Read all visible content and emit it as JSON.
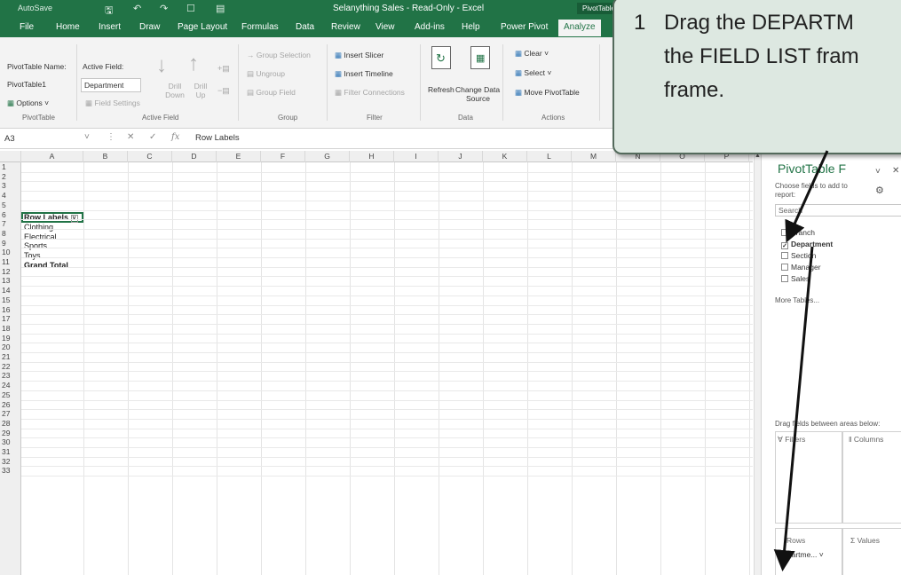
{
  "titlebar": {
    "autosave": "AutoSave",
    "title": "Selanything Sales  -  Read-Only  -  Excel",
    "context_tab": "PivotTable T"
  },
  "ribbon_tabs": [
    "File",
    "Home",
    "Insert",
    "Draw",
    "Page Layout",
    "Formulas",
    "Data",
    "Review",
    "View",
    "Add-ins",
    "Help",
    "Power Pivot",
    "Analyze"
  ],
  "ribbon": {
    "pivottable": {
      "name_label": "PivotTable Name:",
      "name_value": "PivotTable1",
      "options": "Options",
      "group": "PivotTable"
    },
    "active_field": {
      "label": "Active Field:",
      "value": "Department",
      "field_settings": "Field Settings",
      "drill_down": "Drill Down",
      "drill_up": "Drill Up",
      "group": "Active Field"
    },
    "group_grp": {
      "group_selection": "Group Selection",
      "ungroup": "Ungroup",
      "group_field": "Group Field",
      "group": "Group"
    },
    "filter": {
      "insert_slicer": "Insert Slicer",
      "insert_timeline": "Insert Timeline",
      "filter_connections": "Filter Connections",
      "group": "Filter"
    },
    "data": {
      "refresh": "Refresh",
      "change_data": "Change Data",
      "source": "Source",
      "group": "Data"
    },
    "actions": {
      "clear": "Clear",
      "select": "Select",
      "move": "Move PivotTable",
      "group": "Actions"
    }
  },
  "formula_bar": {
    "name_box": "A3",
    "fx": "fx",
    "formula": "Row Labels"
  },
  "columns": [
    "A",
    "B",
    "C",
    "D",
    "E",
    "F",
    "G",
    "H",
    "I",
    "J",
    "K",
    "L",
    "M",
    "N",
    "O",
    "P"
  ],
  "row_count": 33,
  "pivot": {
    "header": "Row Labels",
    "rows": [
      "Clothing",
      "Electrical",
      "Sports",
      "Toys"
    ],
    "total": "Grand Total"
  },
  "task_pane": {
    "title": "PivotTable F",
    "choose": "Choose fields to add to",
    "report": "report:",
    "search": "Search",
    "fields": [
      {
        "label": "Branch",
        "checked": false
      },
      {
        "label": "Department",
        "checked": true
      },
      {
        "label": "Section",
        "checked": false
      },
      {
        "label": "Manager",
        "checked": false
      },
      {
        "label": "Sales",
        "checked": false
      }
    ],
    "more_tables": "More Tables...",
    "drag_hint": "Drag fields between areas below:",
    "filters": "Filters",
    "columns": "Columns",
    "rows": "Rows",
    "values": "Values",
    "rows_item": "Departme..."
  },
  "callout": {
    "number": "1",
    "lines": [
      "Drag the DEPARTM",
      "the FIELD LIST fram",
      "frame."
    ]
  },
  "colors": {
    "excel_green": "#217346",
    "callout_bg": "#dde8e1",
    "arrow": "#111111"
  }
}
